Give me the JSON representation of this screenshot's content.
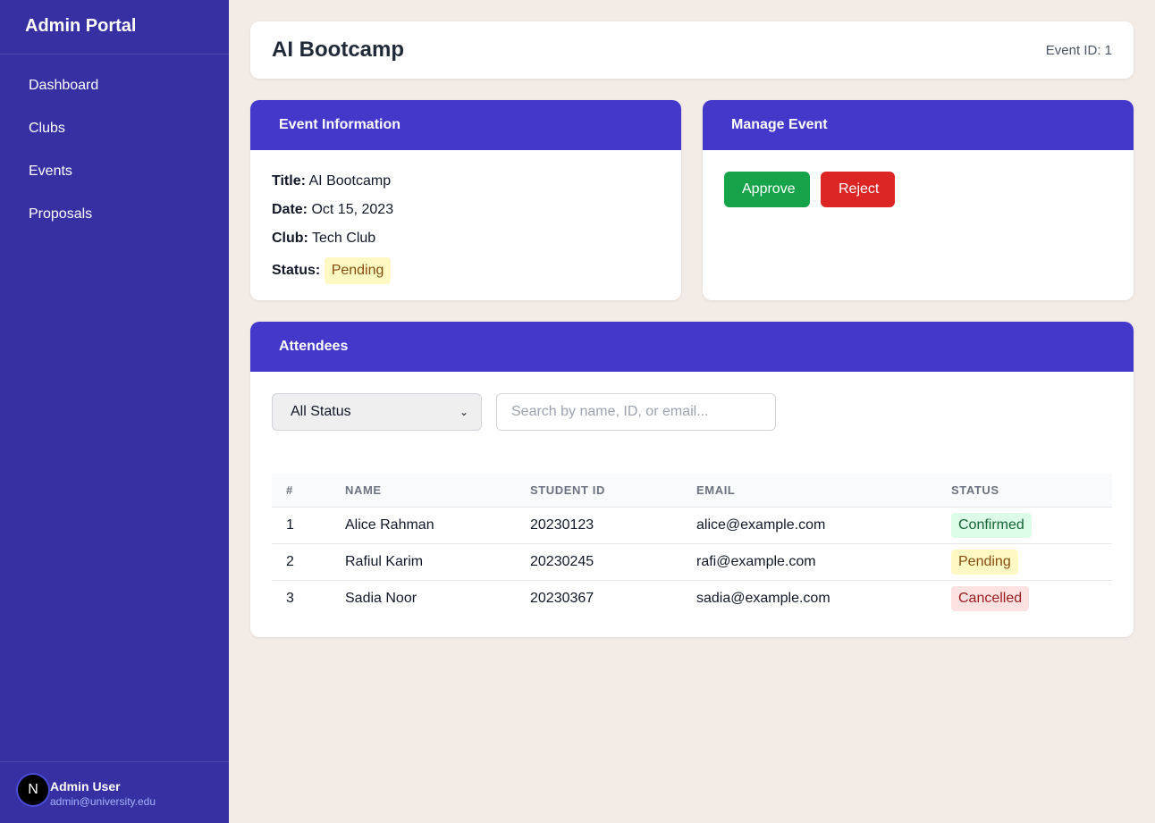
{
  "sidebar": {
    "brand": "Admin Portal",
    "items": [
      {
        "label": "Dashboard"
      },
      {
        "label": "Clubs"
      },
      {
        "label": "Events"
      },
      {
        "label": "Proposals"
      }
    ],
    "user": {
      "avatar_letter": "N",
      "name": "Admin User",
      "email": "admin@university.edu"
    }
  },
  "header": {
    "title": "AI Bootcamp",
    "event_id": "Event ID: 1"
  },
  "event_info": {
    "heading": "Event Information",
    "title_label": "Title:",
    "title_value": "AI Bootcamp",
    "date_label": "Date:",
    "date_value": "Oct 15, 2023",
    "club_label": "Club:",
    "club_value": "Tech Club",
    "status_label": "Status:",
    "status_value": "Pending"
  },
  "manage": {
    "heading": "Manage Event",
    "approve_label": "Approve",
    "reject_label": "Reject"
  },
  "attendees": {
    "heading": "Attendees",
    "filter_selected": "All Status",
    "search_placeholder": "Search by name, ID, or email...",
    "columns": [
      "#",
      "NAME",
      "STUDENT ID",
      "EMAIL",
      "STATUS"
    ],
    "rows": [
      {
        "num": "1",
        "name": "Alice Rahman",
        "student_id": "20230123",
        "email": "alice@example.com",
        "status": "Confirmed"
      },
      {
        "num": "2",
        "name": "Rafiul Karim",
        "student_id": "20230245",
        "email": "rafi@example.com",
        "status": "Pending"
      },
      {
        "num": "3",
        "name": "Sadia Noor",
        "student_id": "20230367",
        "email": "sadia@example.com",
        "status": "Cancelled"
      }
    ]
  },
  "colors": {
    "sidebar": "#3730a3",
    "card_header": "#4338ca",
    "approve": "#16a34a",
    "reject": "#dc2626",
    "background": "#f3ebe5"
  }
}
